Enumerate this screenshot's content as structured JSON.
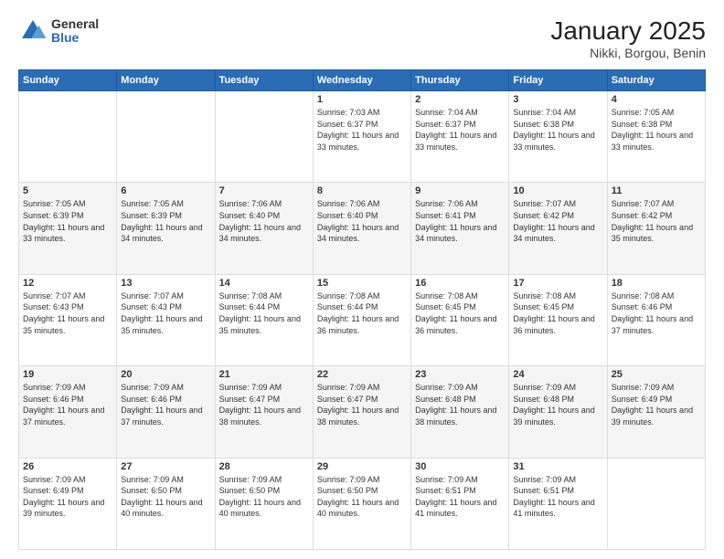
{
  "logo": {
    "general": "General",
    "blue": "Blue"
  },
  "title": "January 2025",
  "subtitle": "Nikki, Borgou, Benin",
  "days_of_week": [
    "Sunday",
    "Monday",
    "Tuesday",
    "Wednesday",
    "Thursday",
    "Friday",
    "Saturday"
  ],
  "weeks": [
    [
      {
        "day": "",
        "info": ""
      },
      {
        "day": "",
        "info": ""
      },
      {
        "day": "",
        "info": ""
      },
      {
        "day": "1",
        "sunrise": "7:03 AM",
        "sunset": "6:37 PM",
        "daylight": "11 hours and 33 minutes."
      },
      {
        "day": "2",
        "sunrise": "7:04 AM",
        "sunset": "6:37 PM",
        "daylight": "11 hours and 33 minutes."
      },
      {
        "day": "3",
        "sunrise": "7:04 AM",
        "sunset": "6:38 PM",
        "daylight": "11 hours and 33 minutes."
      },
      {
        "day": "4",
        "sunrise": "7:05 AM",
        "sunset": "6:38 PM",
        "daylight": "11 hours and 33 minutes."
      }
    ],
    [
      {
        "day": "5",
        "sunrise": "7:05 AM",
        "sunset": "6:39 PM",
        "daylight": "11 hours and 33 minutes."
      },
      {
        "day": "6",
        "sunrise": "7:05 AM",
        "sunset": "6:39 PM",
        "daylight": "11 hours and 34 minutes."
      },
      {
        "day": "7",
        "sunrise": "7:06 AM",
        "sunset": "6:40 PM",
        "daylight": "11 hours and 34 minutes."
      },
      {
        "day": "8",
        "sunrise": "7:06 AM",
        "sunset": "6:40 PM",
        "daylight": "11 hours and 34 minutes."
      },
      {
        "day": "9",
        "sunrise": "7:06 AM",
        "sunset": "6:41 PM",
        "daylight": "11 hours and 34 minutes."
      },
      {
        "day": "10",
        "sunrise": "7:07 AM",
        "sunset": "6:42 PM",
        "daylight": "11 hours and 34 minutes."
      },
      {
        "day": "11",
        "sunrise": "7:07 AM",
        "sunset": "6:42 PM",
        "daylight": "11 hours and 35 minutes."
      }
    ],
    [
      {
        "day": "12",
        "sunrise": "7:07 AM",
        "sunset": "6:43 PM",
        "daylight": "11 hours and 35 minutes."
      },
      {
        "day": "13",
        "sunrise": "7:07 AM",
        "sunset": "6:43 PM",
        "daylight": "11 hours and 35 minutes."
      },
      {
        "day": "14",
        "sunrise": "7:08 AM",
        "sunset": "6:44 PM",
        "daylight": "11 hours and 35 minutes."
      },
      {
        "day": "15",
        "sunrise": "7:08 AM",
        "sunset": "6:44 PM",
        "daylight": "11 hours and 36 minutes."
      },
      {
        "day": "16",
        "sunrise": "7:08 AM",
        "sunset": "6:45 PM",
        "daylight": "11 hours and 36 minutes."
      },
      {
        "day": "17",
        "sunrise": "7:08 AM",
        "sunset": "6:45 PM",
        "daylight": "11 hours and 36 minutes."
      },
      {
        "day": "18",
        "sunrise": "7:08 AM",
        "sunset": "6:46 PM",
        "daylight": "11 hours and 37 minutes."
      }
    ],
    [
      {
        "day": "19",
        "sunrise": "7:09 AM",
        "sunset": "6:46 PM",
        "daylight": "11 hours and 37 minutes."
      },
      {
        "day": "20",
        "sunrise": "7:09 AM",
        "sunset": "6:46 PM",
        "daylight": "11 hours and 37 minutes."
      },
      {
        "day": "21",
        "sunrise": "7:09 AM",
        "sunset": "6:47 PM",
        "daylight": "11 hours and 38 minutes."
      },
      {
        "day": "22",
        "sunrise": "7:09 AM",
        "sunset": "6:47 PM",
        "daylight": "11 hours and 38 minutes."
      },
      {
        "day": "23",
        "sunrise": "7:09 AM",
        "sunset": "6:48 PM",
        "daylight": "11 hours and 38 minutes."
      },
      {
        "day": "24",
        "sunrise": "7:09 AM",
        "sunset": "6:48 PM",
        "daylight": "11 hours and 39 minutes."
      },
      {
        "day": "25",
        "sunrise": "7:09 AM",
        "sunset": "6:49 PM",
        "daylight": "11 hours and 39 minutes."
      }
    ],
    [
      {
        "day": "26",
        "sunrise": "7:09 AM",
        "sunset": "6:49 PM",
        "daylight": "11 hours and 39 minutes."
      },
      {
        "day": "27",
        "sunrise": "7:09 AM",
        "sunset": "6:50 PM",
        "daylight": "11 hours and 40 minutes."
      },
      {
        "day": "28",
        "sunrise": "7:09 AM",
        "sunset": "6:50 PM",
        "daylight": "11 hours and 40 minutes."
      },
      {
        "day": "29",
        "sunrise": "7:09 AM",
        "sunset": "6:50 PM",
        "daylight": "11 hours and 40 minutes."
      },
      {
        "day": "30",
        "sunrise": "7:09 AM",
        "sunset": "6:51 PM",
        "daylight": "11 hours and 41 minutes."
      },
      {
        "day": "31",
        "sunrise": "7:09 AM",
        "sunset": "6:51 PM",
        "daylight": "11 hours and 41 minutes."
      },
      {
        "day": "",
        "info": ""
      }
    ]
  ]
}
